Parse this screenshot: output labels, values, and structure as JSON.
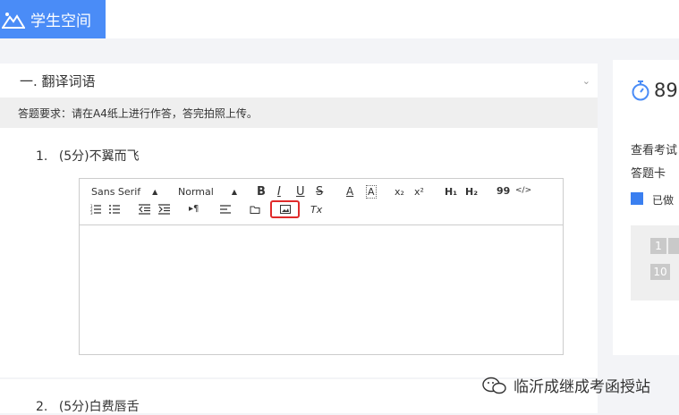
{
  "app": {
    "logo_text": "学生空间"
  },
  "section": {
    "title": "一.  翻译词语",
    "requirement": "答题要求：请在A4纸上进行作答，答完拍照上传。"
  },
  "questions": [
    {
      "label": "1.",
      "text": "(5分)不翼而飞"
    },
    {
      "label": "2.",
      "text": "(5分)白费唇舌"
    }
  ],
  "editor": {
    "font_select": "Sans Serif",
    "size_select": "Normal",
    "bold": "B",
    "italic": "I",
    "underline": "U",
    "strike": "S",
    "color": "A",
    "background": "A",
    "subscript": "x₂",
    "superscript": "x²",
    "h1": "H₁",
    "h2": "H₂",
    "blockquote": "99",
    "code": "</>",
    "direction": "▸¶",
    "clean": "Tx"
  },
  "sidebar": {
    "timer_value": "89",
    "view_exam": "查看考试",
    "answer_card": "答题卡",
    "legend_done": "已做",
    "cells": [
      "1",
      "10"
    ]
  },
  "watermark": {
    "text": "临沂成继成考函授站"
  },
  "colors": {
    "brand": "#4a8cf7",
    "highlight": "#e02a2a",
    "done": "#3a7ff0"
  }
}
